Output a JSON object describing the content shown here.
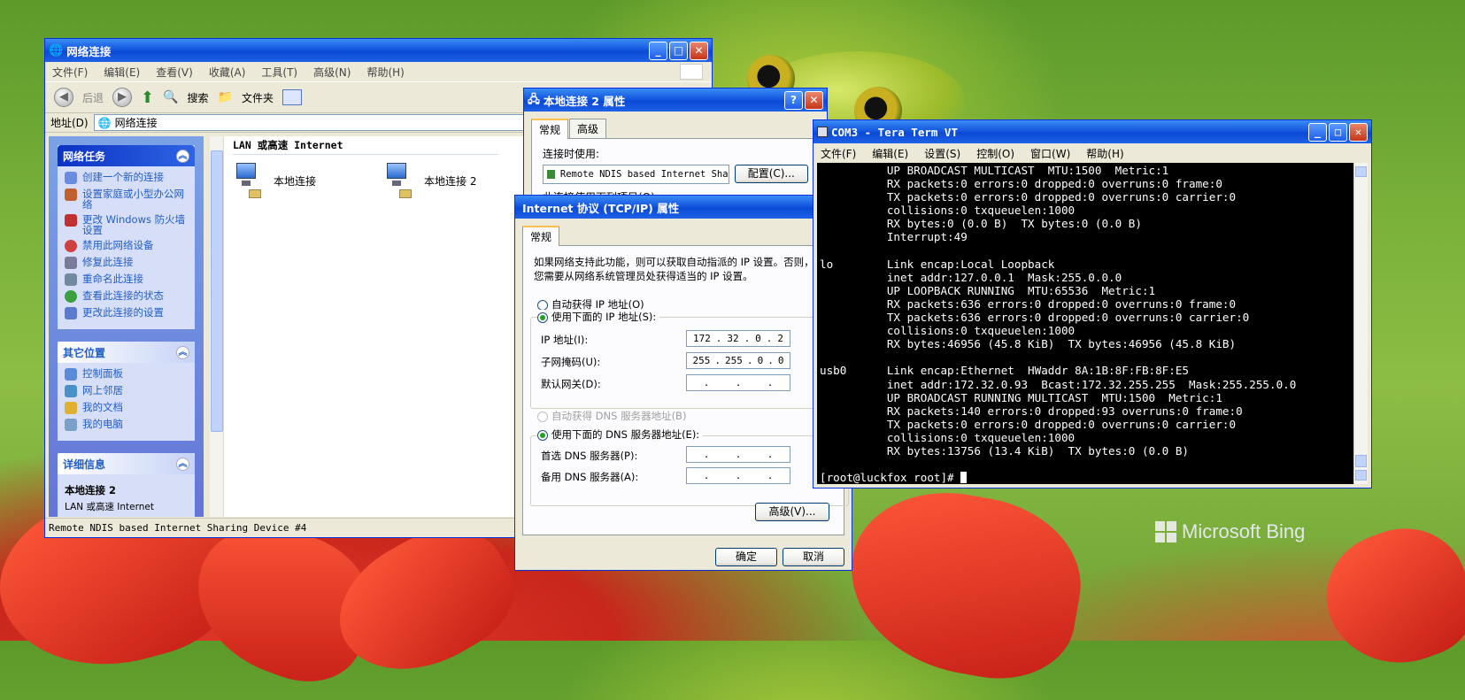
{
  "explorer": {
    "title": "网络连接",
    "menu": [
      "文件(F)",
      "编辑(E)",
      "查看(V)",
      "收藏(A)",
      "工具(T)",
      "高级(N)",
      "帮助(H)"
    ],
    "toolbar": {
      "back": "后退",
      "search": "搜索",
      "folders": "文件夹"
    },
    "address_label": "地址(D)",
    "address_value": "网络连接",
    "tasks_title": "网络任务",
    "tasks": [
      "创建一个新的连接",
      "设置家庭或小型办公网络",
      "更改 Windows 防火墙设置",
      "禁用此网络设备",
      "修复此连接",
      "重命名此连接",
      "查看此连接的状态",
      "更改此连接的设置"
    ],
    "other_title": "其它位置",
    "other": [
      "控制面板",
      "网上邻居",
      "我的文档",
      "我的电脑"
    ],
    "details_title": "详细信息",
    "details_name": "本地连接 2",
    "details_type": "LAN 或高速 Internet",
    "group_header": "LAN 或高速 Internet",
    "connections": [
      "本地连接",
      "本地连接 2"
    ],
    "status": "Remote NDIS based Internet Sharing Device #4"
  },
  "props": {
    "title": "本地连接 2 属性",
    "tabs": [
      "常规",
      "高级"
    ],
    "connect_using": "连接时使用:",
    "adapter": "Remote NDIS based Internet Sha",
    "config_button": "配置(C)...",
    "items_label": "此连接使用下列项目(O):"
  },
  "tcpip": {
    "title": "Internet 协议 (TCP/IP) 属性",
    "tab": "常规",
    "intro1": "如果网络支持此功能，则可以获取自动指派的 IP 设置。否则，",
    "intro2": "您需要从网络系统管理员处获得适当的 IP 设置。",
    "auto_ip": "自动获得 IP 地址(O)",
    "use_ip": "使用下面的 IP 地址(S):",
    "ip_label": "IP 地址(I):",
    "ip_value": [
      "172",
      "32",
      "0",
      "2"
    ],
    "mask_label": "子网掩码(U):",
    "mask_value": [
      "255",
      "255",
      "0",
      "0"
    ],
    "gw_label": "默认网关(D):",
    "auto_dns": "自动获得 DNS 服务器地址(B)",
    "use_dns": "使用下面的 DNS 服务器地址(E):",
    "dns1_label": "首选 DNS 服务器(P):",
    "dns2_label": "备用 DNS 服务器(A):",
    "advanced_button": "高级(V)...",
    "ok_button": "确定",
    "cancel_button": "取消"
  },
  "terminal": {
    "title": "COM3 - Tera Term VT",
    "menu": [
      "文件(F)",
      "编辑(E)",
      "设置(S)",
      "控制(O)",
      "窗口(W)",
      "帮助(H)"
    ],
    "lines": [
      "          UP BROADCAST MULTICAST  MTU:1500  Metric:1",
      "          RX packets:0 errors:0 dropped:0 overruns:0 frame:0",
      "          TX packets:0 errors:0 dropped:0 overruns:0 carrier:0",
      "          collisions:0 txqueuelen:1000",
      "          RX bytes:0 (0.0 B)  TX bytes:0 (0.0 B)",
      "          Interrupt:49",
      "",
      "lo        Link encap:Local Loopback",
      "          inet addr:127.0.0.1  Mask:255.0.0.0",
      "          UP LOOPBACK RUNNING  MTU:65536  Metric:1",
      "          RX packets:636 errors:0 dropped:0 overruns:0 frame:0",
      "          TX packets:636 errors:0 dropped:0 overruns:0 carrier:0",
      "          collisions:0 txqueuelen:1000",
      "          RX bytes:46956 (45.8 KiB)  TX bytes:46956 (45.8 KiB)",
      "",
      "usb0      Link encap:Ethernet  HWaddr 8A:1B:8F:FB:8F:E5",
      "          inet addr:172.32.0.93  Bcast:172.32.255.255  Mask:255.255.0.0",
      "          UP BROADCAST RUNNING MULTICAST  MTU:1500  Metric:1",
      "          RX packets:140 errors:0 dropped:93 overruns:0 frame:0",
      "          TX packets:0 errors:0 dropped:0 overruns:0 carrier:0",
      "          collisions:0 txqueuelen:1000",
      "          RX bytes:13756 (13.4 KiB)  TX bytes:0 (0.0 B)",
      ""
    ],
    "prompt": "[root@luckfox root]# "
  },
  "watermark": "Microsoft Bing"
}
